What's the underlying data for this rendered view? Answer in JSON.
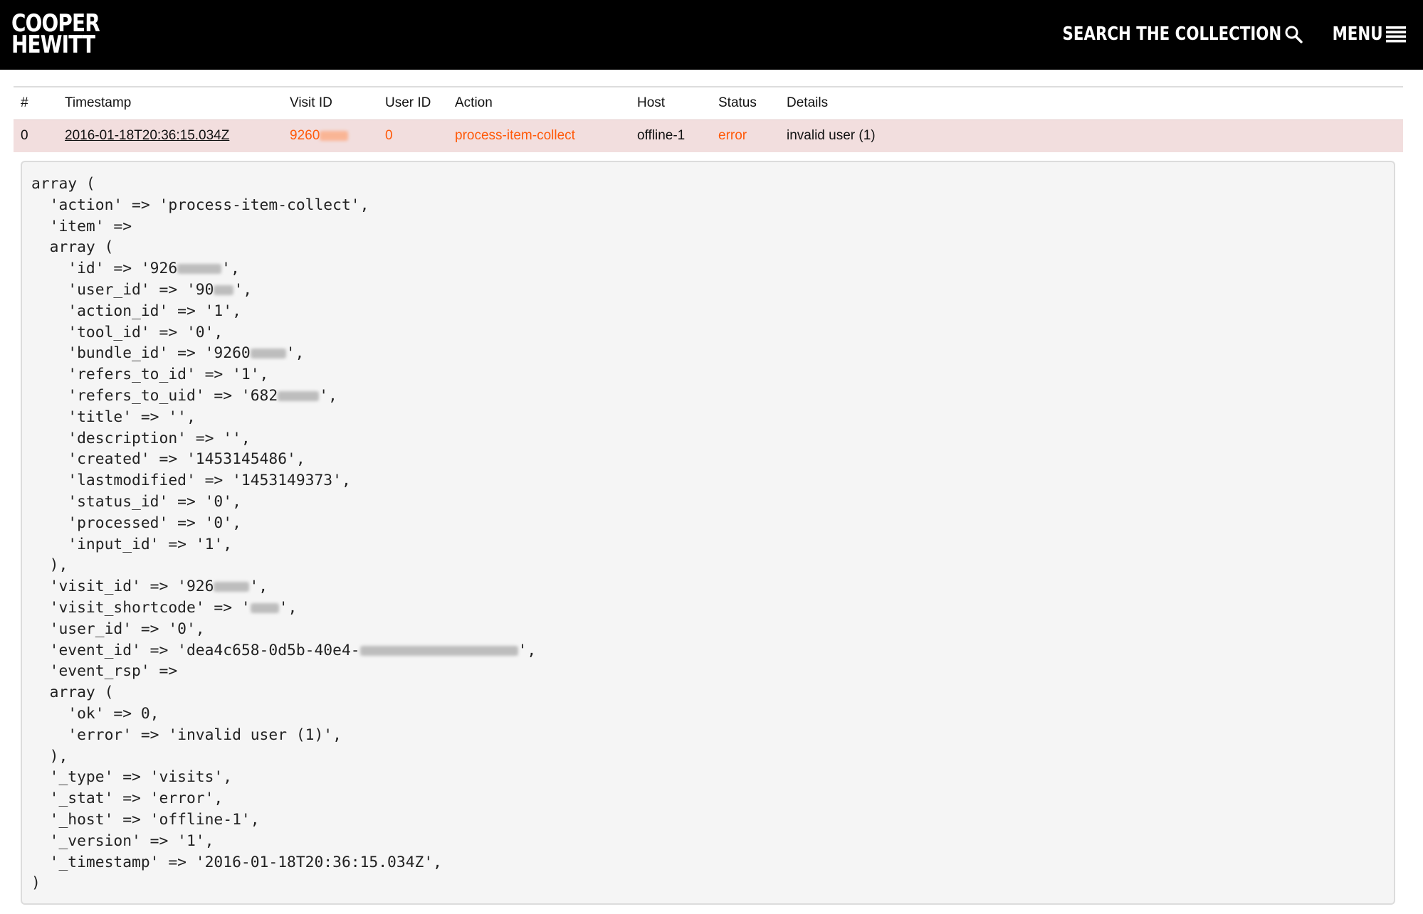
{
  "header": {
    "logo_line1": "COOPER",
    "logo_line2": "HEWITT",
    "search_label": "SEARCH THE COLLECTION",
    "menu_label": "MENU",
    "colors": {
      "bar": "#000000",
      "text": "#ffffff"
    }
  },
  "table": {
    "columns": [
      "#",
      "Timestamp",
      "Visit ID",
      "User ID",
      "Action",
      "Host",
      "Status",
      "Details"
    ],
    "rows": [
      {
        "num": "0",
        "timestamp": "2016-01-18T20:36:15.034Z",
        "visit_id": "9260",
        "user_id": "0",
        "action": "process-item-collect",
        "host": "offline-1",
        "status": "error",
        "details": "invalid user (1)"
      }
    ],
    "colors": {
      "error_row": "#f2dede",
      "accent": "#ff5a0a"
    }
  },
  "detail": {
    "lines": [
      "array (",
      "  'action' => 'process-item-collect',",
      "  'item' =>",
      "  array (",
      "    'id' => '926",
      "    'user_id' => '90",
      "    'action_id' => '1',",
      "    'tool_id' => '0',",
      "    'bundle_id' => '9260",
      "    'refers_to_id' => '1',",
      "    'refers_to_uid' => '682",
      "    'title' => '',",
      "    'description' => '',",
      "    'created' => '1453145486',",
      "    'lastmodified' => '1453149373',",
      "    'status_id' => '0',",
      "    'processed' => '0',",
      "    'input_id' => '1',",
      "  ),",
      "  'visit_id' => '926",
      "  'visit_shortcode' => '",
      "  'user_id' => '0',",
      "  'event_id' => 'dea4c658-0d5b-40e4-",
      "  'event_rsp' =>",
      "  array (",
      "    'ok' => 0,",
      "    'error' => 'invalid user (1)',",
      "  ),",
      "  '_type' => 'visits',",
      "  '_stat' => 'error',",
      "  '_host' => 'offline-1',",
      "  '_version' => '1',",
      "  '_timestamp' => '2016-01-18T20:36:15.034Z',",
      ")"
    ],
    "redacted_line_suffix": "',"
  }
}
